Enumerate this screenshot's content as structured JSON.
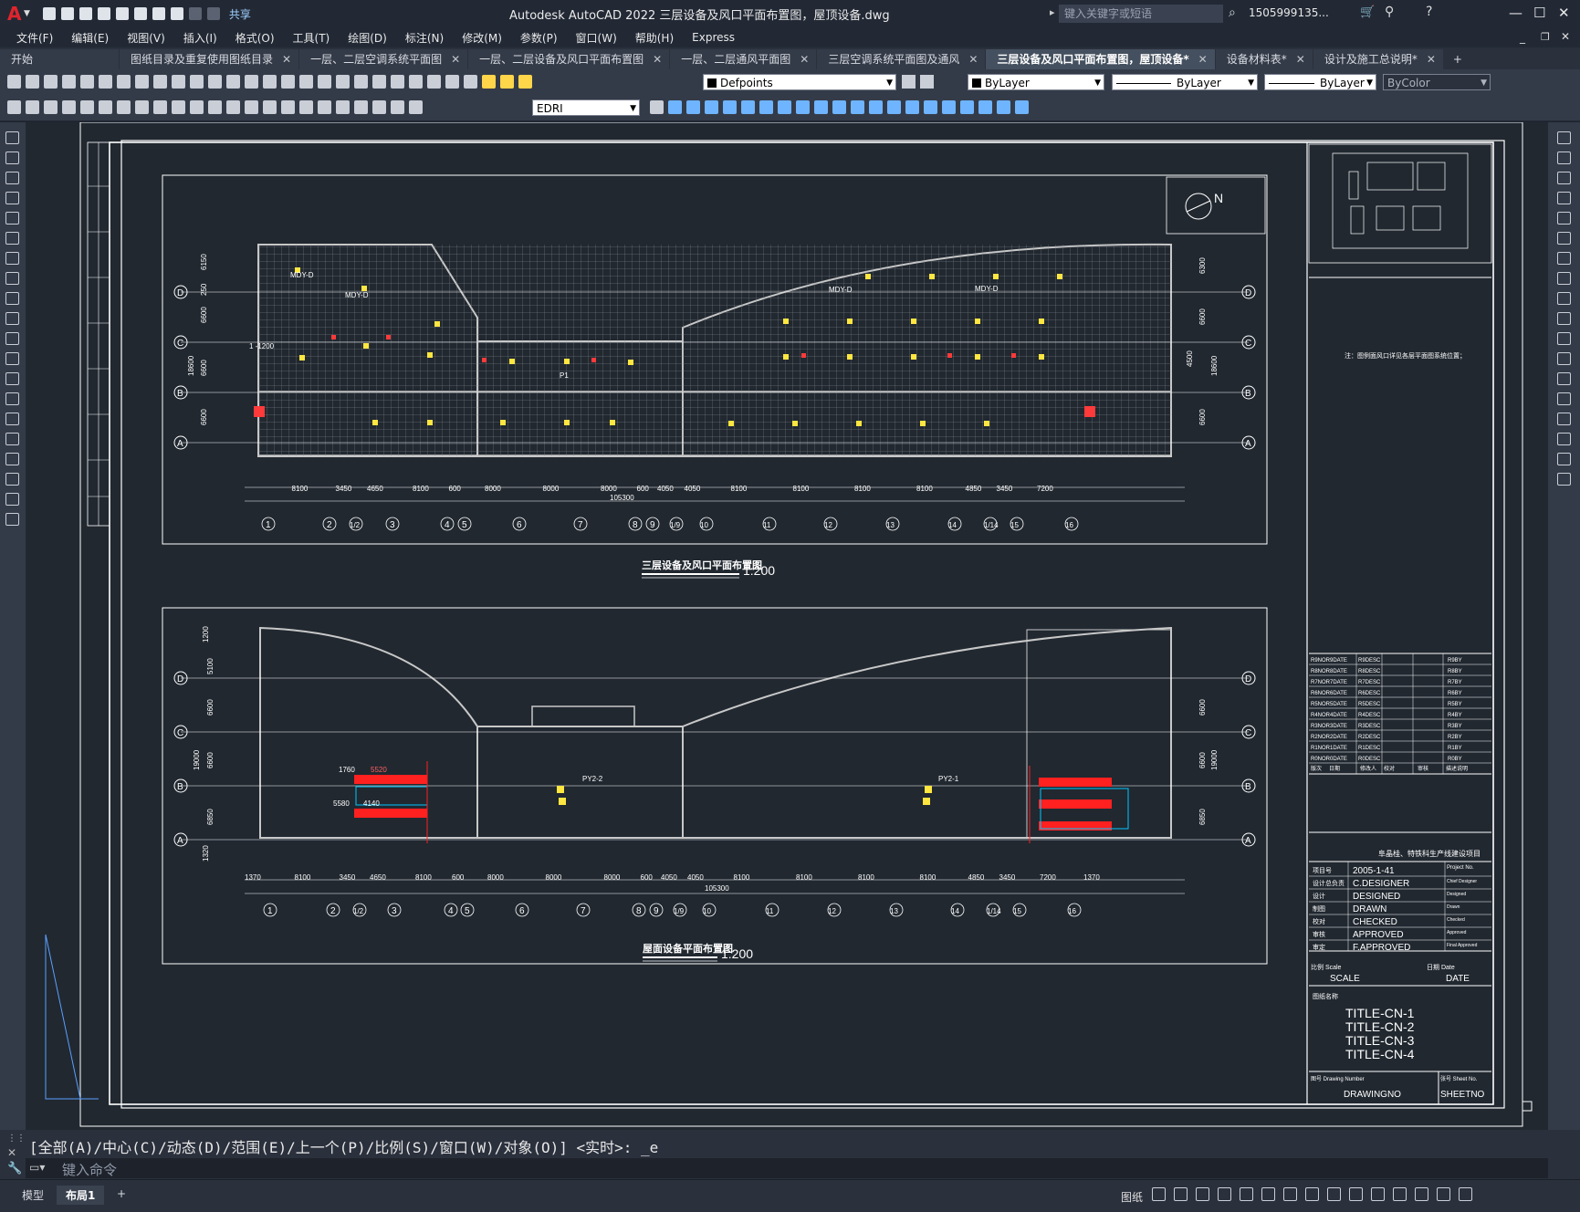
{
  "app": {
    "logo": "A",
    "share_label": "共享",
    "window_title": "Autodesk AutoCAD 2022    三层设备及风口平面布置图，屋顶设备.dwg",
    "search_placeholder": "键入关键字或短语",
    "user": "1505999135...",
    "win_minimize": "—",
    "win_maximize": "☐",
    "win_close": "✕",
    "help_icon": "question-icon"
  },
  "menu": [
    "文件(F)",
    "编辑(E)",
    "视图(V)",
    "插入(I)",
    "格式(O)",
    "工具(T)",
    "绘图(D)",
    "标注(N)",
    "修改(M)",
    "参数(P)",
    "窗口(W)",
    "帮助(H)",
    "Express"
  ],
  "tabs": [
    {
      "label": "开始",
      "closable": false
    },
    {
      "label": "图纸目录及重复使用图纸目录",
      "closable": true
    },
    {
      "label": "一层、二层空调系统平面图",
      "closable": true
    },
    {
      "label": "一层、二层设备及风口平面布置图",
      "closable": true
    },
    {
      "label": "一层、二层通风平面图",
      "closable": true
    },
    {
      "label": "三层空调系统平面图及通风",
      "closable": true
    },
    {
      "label": "三层设备及风口平面布置图，屋顶设备*",
      "closable": true,
      "active": true
    },
    {
      "label": "设备材料表*",
      "closable": true
    },
    {
      "label": "设计及施工总说明*",
      "closable": true
    }
  ],
  "toolbar": {
    "layer": "Defpoints",
    "color": "ByLayer",
    "linetype": "ByLayer",
    "lineweight": "ByLayer",
    "plotstyle": "ByColor",
    "textstyle": "EDRI"
  },
  "drawing": {
    "plan1_title": "三层设备及风口平面布置图",
    "plan2_title": "屋面设备平面布置图",
    "scale": "1:200",
    "north": "N",
    "overall_dim": "105300",
    "dims_top": [
      "8100",
      "3450",
      "4650",
      "8100",
      "600",
      "8000",
      "8000",
      "8000",
      "600",
      "4050",
      "4050",
      "8100",
      "8100",
      "8100",
      "8100",
      "4850",
      "3450",
      "7200"
    ],
    "dims_bot": [
      "1370",
      "8100",
      "3450",
      "4650",
      "8100",
      "600",
      "8000",
      "8000",
      "8000",
      "600",
      "4050",
      "4050",
      "8100",
      "8100",
      "8100",
      "8100",
      "4850",
      "3450",
      "7200",
      "1370"
    ],
    "axes_num": [
      "1",
      "2",
      "1/2",
      "3",
      "4",
      "5",
      "6",
      "7",
      "8",
      "9",
      "1/9",
      "10",
      "11",
      "12",
      "13",
      "14",
      "1/14",
      "15",
      "16"
    ],
    "axes_letters": [
      "D",
      "C",
      "B",
      "A"
    ],
    "left_dims1": [
      "6150",
      "250",
      "6600",
      "6600",
      "6600",
      "18600"
    ],
    "right_dims1": [
      "6300",
      "6600",
      "4500",
      "6600",
      "6600",
      "18600"
    ],
    "left_dims2": [
      "1200",
      "5100",
      "6600",
      "6600",
      "6850",
      "19000",
      "1320"
    ],
    "right_dims2": [
      "6600",
      "6600",
      "6850",
      "19000"
    ],
    "labels_plan1": [
      "MDY-D",
      "MDY-D",
      "MDY-D",
      "MDY-D",
      "P1",
      "1 -1200"
    ],
    "labels_plan2": [
      "PY2-2",
      "PY2-1",
      "5520",
      "1760",
      "4140",
      "5580"
    ],
    "note": "注：图例面风口详见各层平面图系统位置；",
    "revisions": [
      [
        "R9NO",
        "R9DATE",
        "R9DESC",
        "R9BY"
      ],
      [
        "R8NO",
        "R8DATE",
        "R8DESC",
        "R8BY"
      ],
      [
        "R7NO",
        "R7DATE",
        "R7DESC",
        "R7BY"
      ],
      [
        "R6NO",
        "R6DATE",
        "R6DESC",
        "R6BY"
      ],
      [
        "R5NO",
        "R5DATE",
        "R5DESC",
        "R5BY"
      ],
      [
        "R4NO",
        "R4DATE",
        "R4DESC",
        "R4BY"
      ],
      [
        "R3NO",
        "R3DATE",
        "R3DESC",
        "R3BY"
      ],
      [
        "R2NO",
        "R2DATE",
        "R2DESC",
        "R2BY"
      ],
      [
        "R1NO",
        "R1DATE",
        "R1DESC",
        "R1BY"
      ],
      [
        "R0NO",
        "R0DATE",
        "R0DESC",
        "R0BY"
      ]
    ],
    "rev_header": [
      "版次",
      "日期",
      "修改人",
      "校对",
      "审核",
      "描述说明"
    ],
    "project": "阜晶桂、特铁科生产线建设项目",
    "proj_no_label": "项目号",
    "proj_no": "2005-1-41",
    "proj_no_en": "Project No.",
    "roles": [
      {
        "cn": "设计总负责",
        "val": "C.DESIGNER",
        "en": "Chief Designer"
      },
      {
        "cn": "设计",
        "val": "DESIGNED",
        "en": "Designed"
      },
      {
        "cn": "制图",
        "val": "DRAWN",
        "en": "Drawn"
      },
      {
        "cn": "校对",
        "val": "CHECKED",
        "en": "Checked"
      },
      {
        "cn": "审核",
        "val": "APPROVED",
        "en": "Approved"
      },
      {
        "cn": "审定",
        "val": "F.APPROVED",
        "en": "Final Approved"
      }
    ],
    "scale_label": "比例 Scale",
    "scale_val": "SCALE",
    "date_label": "日期 Date",
    "date_val": "DATE",
    "drawing_title_label": "图纸名称",
    "titles": [
      "TITLE-CN-1",
      "TITLE-CN-2",
      "TITLE-CN-3",
      "TITLE-CN-4"
    ],
    "drawing_no_label": "图号 Drawing Number",
    "drawing_no": "DRAWINGNO",
    "sheet_no_label": "张号 Sheet No.",
    "sheet_no": "SHEETNO"
  },
  "command": {
    "history": "[全部(A)/中心(C)/动态(D)/范围(E)/上一个(P)/比例(S)/窗口(W)/对象(O)] <实时>: _e",
    "placeholder": "键入命令"
  },
  "status": {
    "model_tab": "模型",
    "layout_tab": "布局1",
    "add_tab": "+",
    "paper": "图纸"
  }
}
